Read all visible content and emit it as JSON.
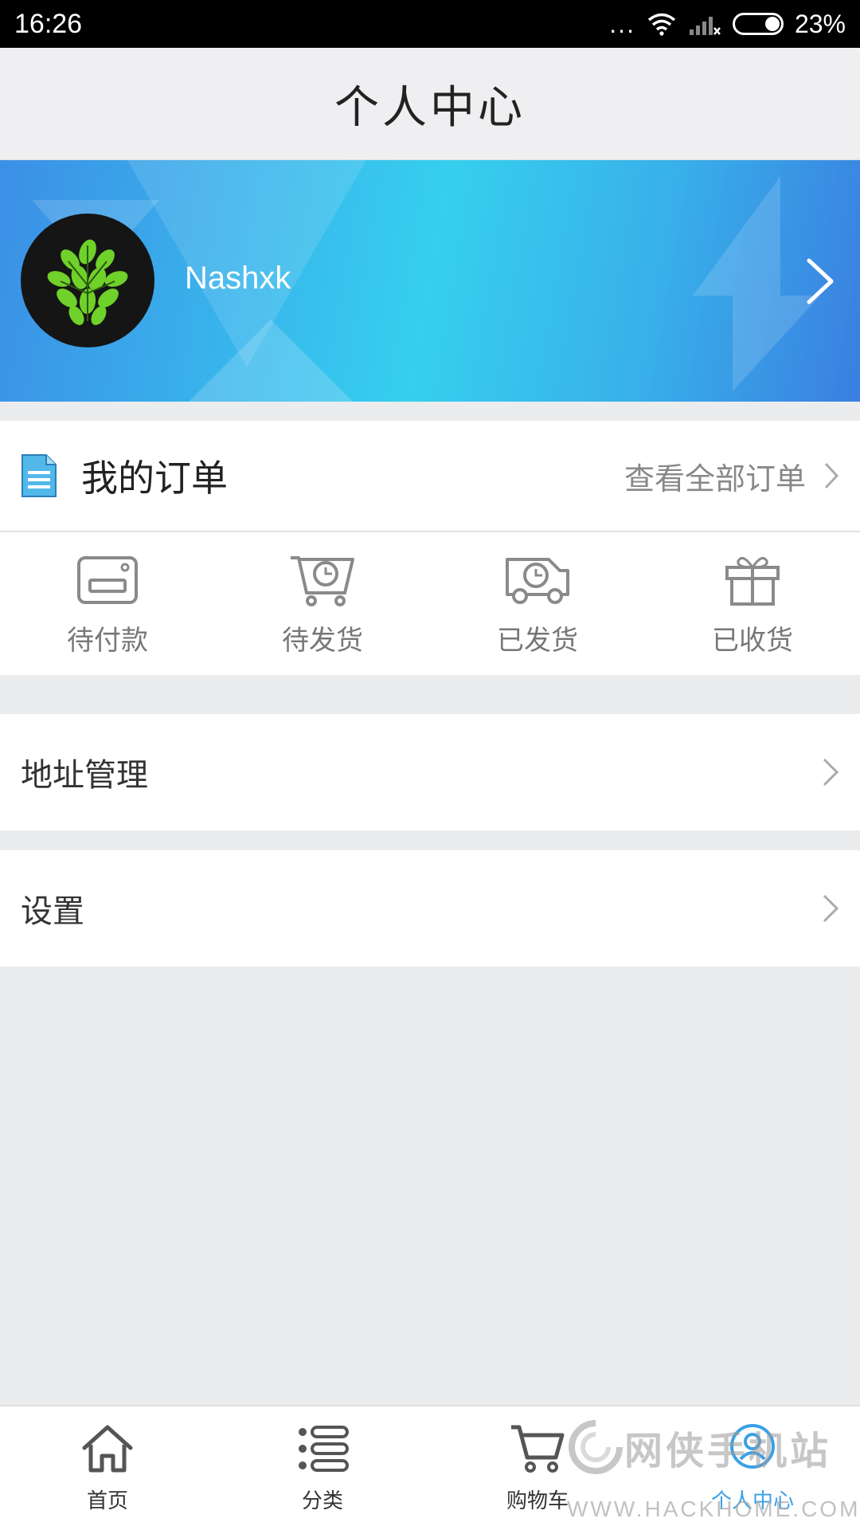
{
  "status_bar": {
    "time": "16:26",
    "dots": "...",
    "battery_percent": "23%",
    "battery_level": 0.23
  },
  "header": {
    "title": "个人中心"
  },
  "profile": {
    "username": "Nashxk"
  },
  "orders": {
    "title": "我的订单",
    "view_all": "查看全部订单",
    "statuses": [
      {
        "label": "待付款",
        "icon": "wallet-icon"
      },
      {
        "label": "待发货",
        "icon": "cart-clock-icon"
      },
      {
        "label": "已发货",
        "icon": "truck-icon"
      },
      {
        "label": "已收货",
        "icon": "gift-icon"
      }
    ]
  },
  "menu": {
    "address": "地址管理",
    "settings": "设置"
  },
  "tabbar": {
    "items": [
      {
        "label": "首页",
        "icon": "home-icon"
      },
      {
        "label": "分类",
        "icon": "list-icon"
      },
      {
        "label": "购物车",
        "icon": "cart-icon"
      },
      {
        "label": "个人中心",
        "icon": "person-icon",
        "active": true
      }
    ],
    "active_color": "#3aa1e6"
  },
  "watermark": {
    "text": "网侠手机站",
    "url": "WWW.HACKHOME.COM"
  },
  "colors": {
    "banner_blue": "#36cfee",
    "background": "#ebecee"
  }
}
